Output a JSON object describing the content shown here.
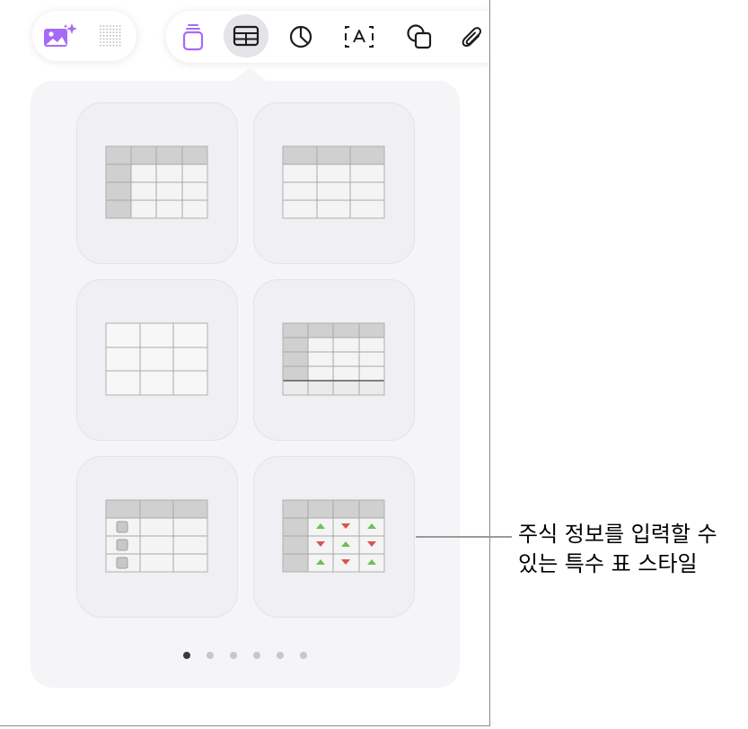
{
  "toolbar": {
    "left_group": [
      "image-playground-icon",
      "grid-dots-icon"
    ],
    "right_group": [
      "text-box-styles-icon",
      "table-icon",
      "chart-icon",
      "text-icon",
      "shape-icon",
      "attachment-icon"
    ],
    "active": "table-icon",
    "accent_color": "#9b5cf6"
  },
  "table_styles": {
    "tiles": [
      {
        "name": "header-row-and-column-table"
      },
      {
        "name": "header-row-table"
      },
      {
        "name": "plain-table"
      },
      {
        "name": "header-row-column-footer-table"
      },
      {
        "name": "checklist-table"
      },
      {
        "name": "stock-table"
      }
    ]
  },
  "pagination": {
    "page_count": 6,
    "current_page": 1
  },
  "callout": {
    "line1": "주식 정보를 입력할 수",
    "line2": "있는 특수 표 스타일"
  }
}
